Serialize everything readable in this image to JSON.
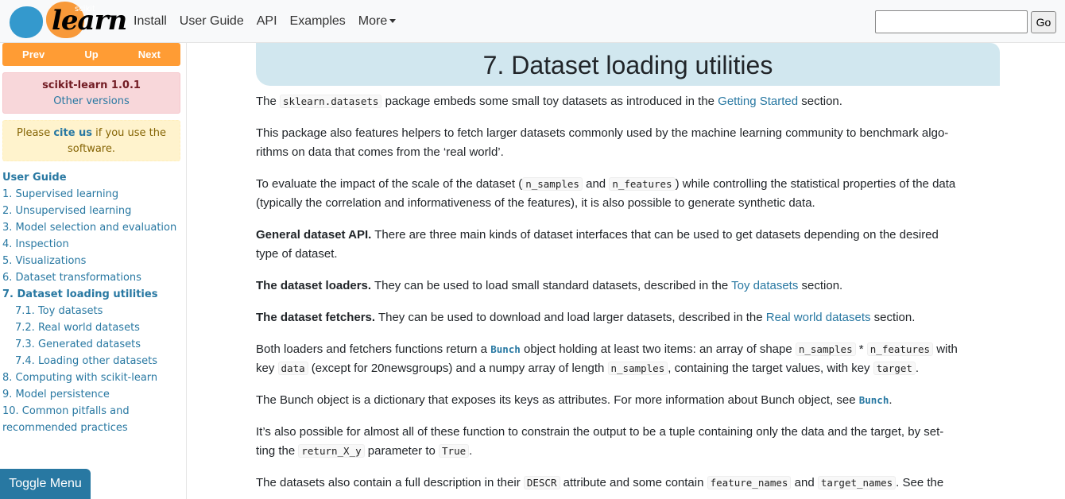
{
  "logo": {
    "top_text": "scikit",
    "main_text": "learn"
  },
  "nav": {
    "install": "Install",
    "user_guide": "User Guide",
    "api": "API",
    "examples": "Examples",
    "more": "More"
  },
  "search": {
    "go": "Go",
    "placeholder": ""
  },
  "pager": {
    "prev": "Prev",
    "up": "Up",
    "next": "Next"
  },
  "version": {
    "title": "scikit-learn 1.0.1",
    "other": "Other versions"
  },
  "cite": {
    "before": "Please ",
    "link": "cite us",
    "after": " if you use the software."
  },
  "toc": {
    "heading": "User Guide",
    "items": [
      "1. Supervised learning",
      "2. Unsupervised learning",
      "3. Model selection and evaluation",
      "4. Inspection",
      "5. Visualizations",
      "6. Dataset transformations",
      "7. Dataset loading utilities",
      "7.1. Toy datasets",
      "7.2. Real world datasets",
      "7.3. Generated datasets",
      "7.4. Loading other datasets",
      "8. Computing with scikit-learn",
      "9. Model persistence",
      "10. Common pitfalls and",
      "recommended practices"
    ]
  },
  "toggle_menu": "Toggle Menu",
  "main": {
    "title": "7. Dataset loading utilities",
    "p1": {
      "a": "The ",
      "code": "sklearn.datasets",
      "b": " package embeds some small toy datasets as introduced in the ",
      "link": "Getting Started",
      "c": " section."
    },
    "p2": {
      "line1": "This package also features helpers to fetch larger datasets commonly used by the machine learning community to benchmark algo-",
      "line2": "rithms on data that comes from the ‘real world’."
    },
    "p3": {
      "a": "To evaluate the impact of the scale of the dataset (",
      "code1": "n_samples",
      "b": " and ",
      "code2": "n_features",
      "c": ") while controlling the statistical properties of the data",
      "line2": "(typically the correlation and informativeness of the features), it is also possible to generate synthetic data."
    },
    "p4": {
      "bold": "General dataset API.",
      "text": " There are three main kinds of dataset interfaces that can be used to get datasets depending on the desired",
      "line2": "type of dataset."
    },
    "p5": {
      "bold": "The dataset loaders.",
      "text": " They can be used to load small standard datasets, described in the ",
      "link": "Toy datasets",
      "end": " section."
    },
    "p6": {
      "bold": "The dataset fetchers.",
      "text": " They can be used to download and load larger datasets, described in the ",
      "link": "Real world datasets",
      "end": " section."
    },
    "p7": {
      "a": "Both loaders and fetchers functions return a ",
      "bunch": "Bunch",
      "b": " object holding at least two items: an array of shape ",
      "code1": "n_samples",
      "c": " * ",
      "code2": "n_features",
      "d": " with",
      "e": "key ",
      "code3": "data",
      "f": " (except for 20newsgroups) and a numpy array of length ",
      "code4": "n_samples",
      "g": ", containing the target values, with key ",
      "code5": "target",
      "h": "."
    },
    "p8": {
      "a": "The Bunch object is a dictionary that exposes its keys as attributes. For more information about Bunch object, see ",
      "bunch": "Bunch",
      "b": "."
    },
    "p9": {
      "line1": "It’s also possible for almost all of these function to constrain the output to be a tuple containing only the data and the target, by set-",
      "a": "ting the ",
      "code1": "return_X_y",
      "b": " parameter to ",
      "code2": "True",
      "c": "."
    },
    "p10": {
      "a": "The datasets also contain a full description in their ",
      "code1": "DESCR",
      "b": " attribute and some contain ",
      "code2": "feature_names",
      "c": " and ",
      "code3": "target_names",
      "d": ". See the"
    }
  }
}
